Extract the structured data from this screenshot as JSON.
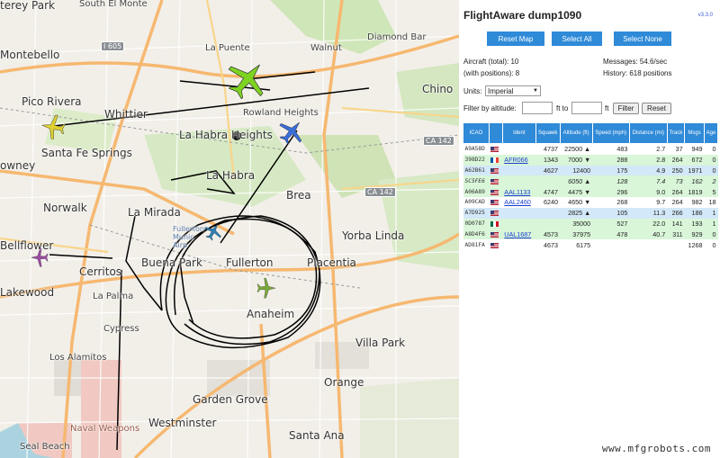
{
  "map": {
    "cities": {
      "monterey_park": "terey Park",
      "south_el_monte": "South El Monte",
      "montebello": "Montebello",
      "la_puente": "La Puente",
      "walnut": "Walnut",
      "diamond_bar": "Diamond Bar",
      "pico_rivera": "Pico Rivera",
      "whittier": "Whittier",
      "chino": "Chino",
      "rowland_heights": "Rowland Heights",
      "la_habra_heights": "La Habra Heights",
      "santa_fe_springs": "Santa Fe Springs",
      "downey": "owney",
      "la_habra": "La Habra",
      "norwalk": "Norwalk",
      "brea": "Brea",
      "la_mirada": "La Mirada",
      "yorba_linda": "Yorba Linda",
      "bellflower": "Bellflower",
      "cerritos": "Cerritos",
      "buena_park": "Buena Park",
      "fullerton": "Fullerton",
      "placentia": "Placentia",
      "lakewood": "Lakewood",
      "la_palma": "La Palma",
      "cypress": "Cypress",
      "anaheim": "Anaheim",
      "villa_park": "Villa Park",
      "los_alamitos": "Los Alamitos",
      "orange": "Orange",
      "garden_grove": "Garden Grove",
      "westminster": "Westminster",
      "santa_ana": "Santa Ana",
      "seal_beach": "Seal Beach",
      "naval_weapons": "Naval Weapons",
      "fullerton_muni": "Fullerton Munic Airp"
    },
    "highways": {
      "i605": "I 605",
      "ca142_a": "CA 142",
      "ca142_b": "CA 142"
    },
    "airplane_colors": [
      "#7ed321",
      "#3a6fd8",
      "#e0d030",
      "#2f7fb0",
      "#9a4ba0",
      "#7aa83a"
    ]
  },
  "panel": {
    "title": "FlightAware dump1090",
    "version": "v3.3.0",
    "buttons": {
      "reset_map": "Reset Map",
      "select_all": "Select All",
      "select_none": "Select None"
    },
    "stats": {
      "aircraft_total": "Aircraft (total): 10",
      "with_positions": "(with positions): 8",
      "messages": "Messages: 54.6/sec",
      "history": "History: 618 positions"
    },
    "units_label": "Units:",
    "units_value": "Imperial",
    "filter": {
      "label": "Filter by altitude:",
      "ft_to": "ft to",
      "ft": "ft",
      "filter_button": "Filter",
      "reset_button": "Reset"
    },
    "columns": [
      "ICAO",
      "",
      "Ident",
      "Squawk",
      "Altitude (ft)",
      "Speed (mph)",
      "Distance (mi)",
      "Track",
      "Msgs",
      "Age"
    ],
    "rows": [
      {
        "icao": "A9A58D",
        "flag": "us",
        "ident": "",
        "squawk": "4737",
        "altitude": "22500 ▲",
        "speed": "483",
        "distance": "2.7",
        "track": "37",
        "msgs": "949",
        "age": "0",
        "style": "w",
        "italic": false,
        "link": false
      },
      {
        "icao": "398D22",
        "flag": "fr",
        "ident": "AFR066",
        "squawk": "1343",
        "altitude": "7000 ▼",
        "speed": "288",
        "distance": "2.8",
        "track": "264",
        "msgs": "672",
        "age": "0",
        "style": "g",
        "italic": false,
        "link": true
      },
      {
        "icao": "A62B61",
        "flag": "us",
        "ident": "",
        "squawk": "4627",
        "altitude": "12400",
        "speed": "175",
        "distance": "4.9",
        "track": "250",
        "msgs": "1971",
        "age": "0",
        "style": "b",
        "italic": false,
        "link": false
      },
      {
        "icao": "5C5FE6",
        "flag": "us",
        "ident": "",
        "squawk": "",
        "altitude": "6050 ▲",
        "speed": "128",
        "distance": "7.4",
        "track": "73",
        "msgs": "162",
        "age": "2",
        "style": "g",
        "italic": true,
        "link": false
      },
      {
        "icao": "A06A89",
        "flag": "us",
        "ident": "AAL1133",
        "squawk": "4747",
        "altitude": "4475 ▼",
        "speed": "296",
        "distance": "9.0",
        "track": "264",
        "msgs": "1819",
        "age": "5",
        "style": "g",
        "italic": false,
        "link": true
      },
      {
        "icao": "A09CAD",
        "flag": "us",
        "ident": "AAL2460",
        "squawk": "6240",
        "altitude": "4650 ▼",
        "speed": "268",
        "distance": "9.7",
        "track": "264",
        "msgs": "982",
        "age": "18",
        "style": "w",
        "italic": false,
        "link": true
      },
      {
        "icao": "A7D925",
        "flag": "us",
        "ident": "",
        "squawk": "",
        "altitude": "2825 ▲",
        "speed": "105",
        "distance": "11.3",
        "track": "266",
        "msgs": "186",
        "age": "1",
        "style": "b",
        "italic": false,
        "link": false
      },
      {
        "icao": "0D0787",
        "flag": "mx",
        "ident": "",
        "squawk": "",
        "altitude": "35000",
        "speed": "527",
        "distance": "22.0",
        "track": "141",
        "msgs": "193",
        "age": "1",
        "style": "g",
        "italic": false,
        "link": false
      },
      {
        "icao": "A8D4F6",
        "flag": "us",
        "ident": "UAL1687",
        "squawk": "4573",
        "altitude": "37975",
        "speed": "478",
        "distance": "40.7",
        "track": "311",
        "msgs": "929",
        "age": "0",
        "style": "g",
        "italic": false,
        "link": true
      },
      {
        "icao": "AD81FA",
        "flag": "us",
        "ident": "",
        "squawk": "4673",
        "altitude": "6175",
        "speed": "",
        "distance": "",
        "track": "",
        "msgs": "1268",
        "age": "0",
        "style": "w",
        "italic": false,
        "link": false
      }
    ]
  },
  "watermark": "www.mfgrobots.com"
}
